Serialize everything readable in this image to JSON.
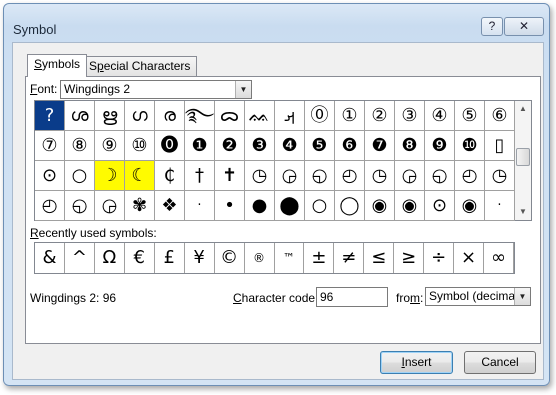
{
  "window": {
    "title": "Symbol",
    "help_label": "?",
    "close_label": "✕"
  },
  "tabs": [
    {
      "label_prefix": "",
      "label_hot": "S",
      "label_rest": "ymbols"
    },
    {
      "label_prefix": "S",
      "label_hot": "p",
      "label_rest": "ecial Characters"
    }
  ],
  "font": {
    "label_hot": "F",
    "label_rest": "ont:",
    "value": "Wingdings 2"
  },
  "grid": {
    "rows": [
      [
        "?",
        "ശ",
        "ഋ",
        "ഗ",
        "ര",
        "࿐",
        "ᯅ",
        "ᨐ",
        "ࡕ",
        "⓪",
        "①",
        "②",
        "③",
        "④",
        "⑤",
        "⑥"
      ],
      [
        "⑦",
        "⑧",
        "⑨",
        "⑩",
        "⓿",
        "❶",
        "❷",
        "❸",
        "❹",
        "❺",
        "❻",
        "❼",
        "❽",
        "❾",
        "❿",
        "▯"
      ],
      [
        "⊙",
        "○",
        "☽",
        "☾",
        "₵",
        "†",
        "✝",
        "◷",
        "◶",
        "◵",
        "◴",
        "◷",
        "◶",
        "◵",
        "◴",
        "◷"
      ],
      [
        "◴",
        "◵",
        "◶",
        "✾",
        "❖",
        "·",
        "•",
        "●",
        "⬤",
        "○",
        "◯",
        "◉",
        "◉",
        "⊙",
        "◉",
        "·"
      ]
    ]
  },
  "recent": {
    "label_hot": "R",
    "label_rest": "ecently used symbols:",
    "symbols": [
      "&",
      "^",
      "Ω",
      "€",
      "£",
      "¥",
      "©",
      "®",
      "™",
      "±",
      "≠",
      "≤",
      "≥",
      "÷",
      "×",
      "∞"
    ]
  },
  "status": {
    "text": "Wingdings 2: 96"
  },
  "char_code": {
    "label_hot": "C",
    "label_rest": "haracter code:",
    "value": "96"
  },
  "from": {
    "label_hot": "m",
    "label_pre": "fro",
    "label_rest": ":",
    "value": "Symbol (decimal)"
  },
  "buttons": {
    "insert": "Insert",
    "cancel": "Cancel"
  },
  "colors": {
    "highlight": "#fffb00",
    "selected": "#0a3c8a"
  }
}
